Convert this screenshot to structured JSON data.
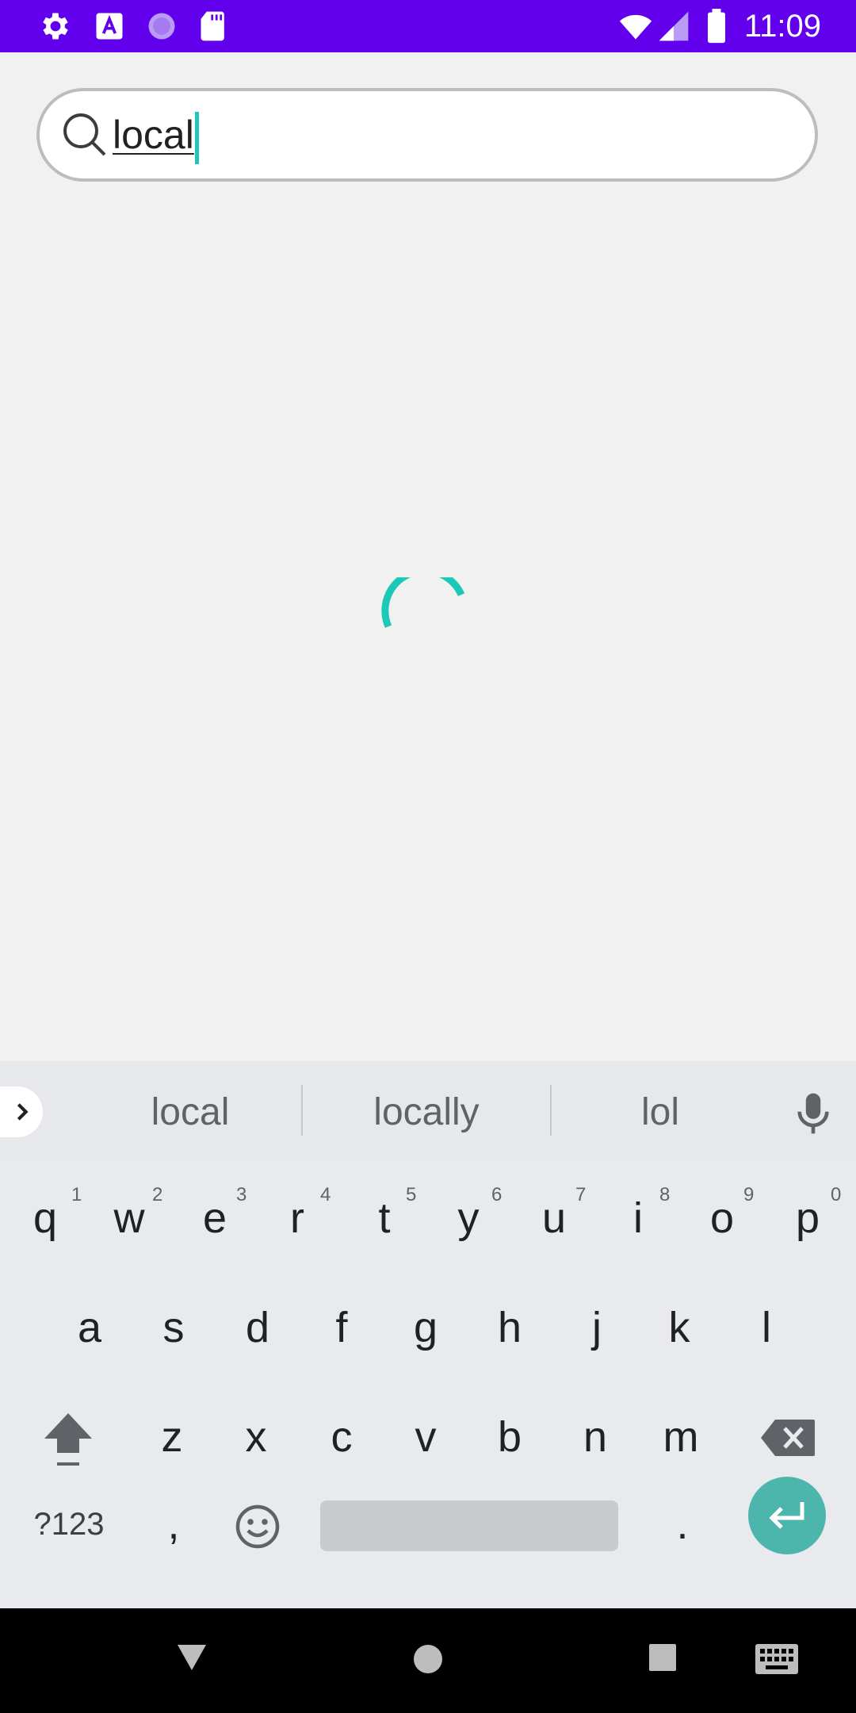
{
  "status_bar": {
    "time": "11:09",
    "icons": [
      "gear-icon",
      "text-a-icon",
      "loading-circle-icon",
      "sd-card-icon",
      "wifi-icon",
      "signal-icon",
      "battery-icon"
    ],
    "background": "#6200ee"
  },
  "search": {
    "query": "local",
    "accent": "#1ec8b8"
  },
  "keyboard": {
    "suggestions": [
      "local",
      "locally",
      "lol"
    ],
    "row1": [
      {
        "key": "q",
        "hint": "1"
      },
      {
        "key": "w",
        "hint": "2"
      },
      {
        "key": "e",
        "hint": "3"
      },
      {
        "key": "r",
        "hint": "4"
      },
      {
        "key": "t",
        "hint": "5"
      },
      {
        "key": "y",
        "hint": "6"
      },
      {
        "key": "u",
        "hint": "7"
      },
      {
        "key": "i",
        "hint": "8"
      },
      {
        "key": "o",
        "hint": "9"
      },
      {
        "key": "p",
        "hint": "0"
      }
    ],
    "row2": [
      "a",
      "s",
      "d",
      "f",
      "g",
      "h",
      "j",
      "k",
      "l"
    ],
    "row3": [
      "z",
      "x",
      "c",
      "v",
      "b",
      "n",
      "m"
    ],
    "symbols_label": "?123",
    "comma": ",",
    "period": ".",
    "enter_color": "#4db6ac"
  },
  "nav_bar": {
    "buttons": [
      "back-icon",
      "home-icon",
      "recents-icon",
      "keyboard-icon"
    ]
  }
}
